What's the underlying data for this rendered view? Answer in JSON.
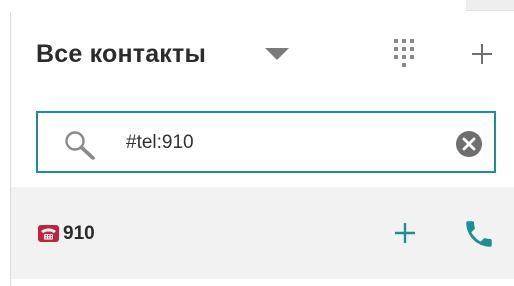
{
  "header": {
    "title": "Все контакты",
    "icons": [
      "dropdown-arrow-icon",
      "dialpad-icon",
      "add-icon"
    ]
  },
  "search": {
    "value": "#tel:910",
    "icons": [
      "search-icon",
      "clear-icon"
    ]
  },
  "results": [
    {
      "number": "910",
      "icons": [
        "phone-badge-icon",
        "add-icon",
        "call-icon"
      ]
    }
  ],
  "colors": {
    "accent": "#1a8f94",
    "badge": "#c0233a",
    "title_text": "#2b2b2b",
    "row_background": "#f2f2f2"
  }
}
